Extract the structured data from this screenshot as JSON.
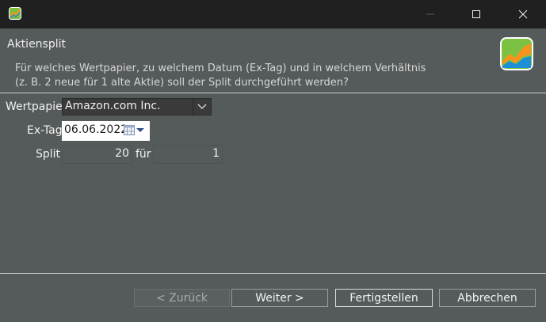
{
  "window": {
    "title": ""
  },
  "header": {
    "title": "Aktiensplit",
    "description_line1": "Für welches Wertpapier, zu welchem Datum (Ex-Tag) und in welchem Verhältnis",
    "description_line2": "(z. B. 2 neue für 1 alte Aktie) soll der Split durchgeführt werden?"
  },
  "form": {
    "security_label": "Wertpapier",
    "security_value": "Amazon.com Inc.",
    "exdate_label": "Ex-Tag",
    "exdate_value": "06.06.2022",
    "split_label": "Split",
    "split_new": "20",
    "split_for": "für",
    "split_old": "1"
  },
  "buttons": {
    "back": "< Zurück",
    "next": "Weiter >",
    "finish": "Fertigstellen",
    "cancel": "Abbrechen"
  },
  "colors": {
    "background": "#555a5b",
    "titlebar": "#202020",
    "text": "#f2f2f2"
  },
  "icons": [
    "app-logo-icon",
    "minimize-icon",
    "maximize-icon",
    "close-icon",
    "chevron-down-icon",
    "calendar-icon"
  ]
}
